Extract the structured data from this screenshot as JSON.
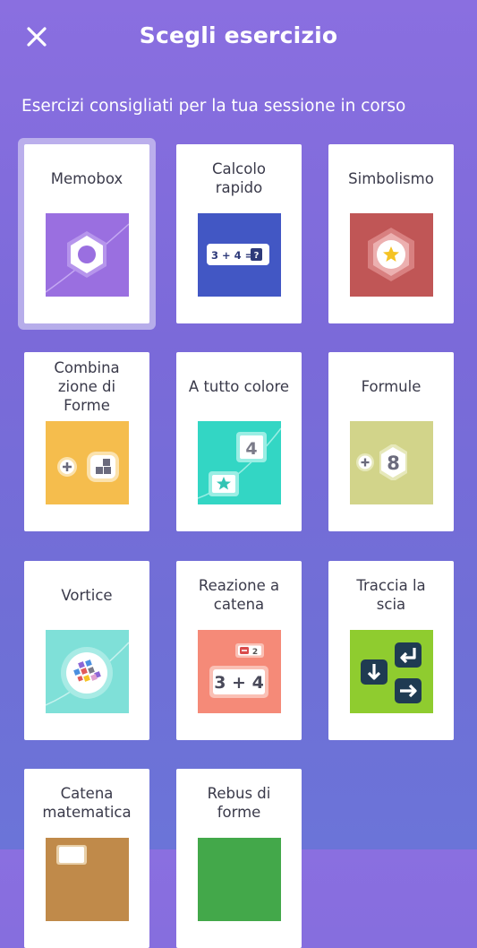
{
  "header": {
    "title": "Scegli esercizio",
    "close_icon": "close-icon"
  },
  "subtitle": "Esercizi consigliati per la tua sessione in corso",
  "exercises": [
    {
      "label": "Memobox",
      "color": "#9a6fe0",
      "icon": "hexagon-ring-icon",
      "selected": true
    },
    {
      "label": "Calcolo\nrapido",
      "color": "#4257c4",
      "icon": "equation-icon",
      "equation": "3 + 4 =",
      "unknown": "?"
    },
    {
      "label": "Simbolismo",
      "color": "#c05656",
      "icon": "star-hexagon-icon"
    },
    {
      "label": "Combina\nzione di\nForme",
      "color": "#f5bd4d",
      "icon": "plus-shapes-icon"
    },
    {
      "label": "A tutto colore",
      "color": "#33d6c4",
      "icon": "number-star-icon",
      "number": "4"
    },
    {
      "label": "Formule",
      "color": "#d2d48a",
      "icon": "plus-number-icon",
      "number": "8"
    },
    {
      "label": "Vortice",
      "color": "#7fe0d8",
      "icon": "vortex-icon"
    },
    {
      "label": "Reazione a\ncatena",
      "color": "#f58a78",
      "icon": "chain-equation-icon",
      "top_number": "2",
      "equation": "3 + 4"
    },
    {
      "label": "Traccia la\nscia",
      "color": "#8fcc2f",
      "icon": "arrows-icon"
    },
    {
      "label": "Catena\nmatematica",
      "color": "#c08a4a",
      "icon": "math-chain-icon"
    },
    {
      "label": "Rebus di\nforme",
      "color": "#43a84a",
      "icon": "shape-rebus-icon"
    }
  ]
}
